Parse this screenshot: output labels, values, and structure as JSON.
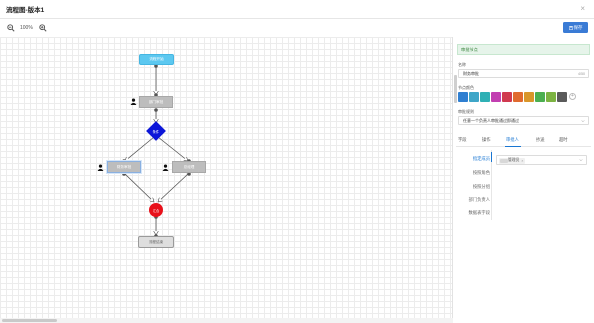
{
  "window": {
    "title": "流程图-版本1",
    "close_glyph": "×"
  },
  "toolbar": {
    "zoom_out_icon": "zoom-out-icon",
    "zoom_value": "100%",
    "zoom_in_icon": "zoom-in-icon",
    "save_label": "保存",
    "save_icon": "save-icon",
    "save_color": "#3a7bd5"
  },
  "flow": {
    "start": "流程开始",
    "task1": "部门审批",
    "gateway": "条件",
    "task2": "财务审批",
    "task3": "总经理",
    "merge": "汇合",
    "end": "流程结束"
  },
  "panel": {
    "banner": "审批节点",
    "name_label": "名称",
    "name_value": "财务审批",
    "name_counter": "4/50",
    "color_label": "节点颜色",
    "colors": [
      "#2f7fd1",
      "#3fa6c8",
      "#2fb0b5",
      "#c23fb1",
      "#d03a4f",
      "#e06a2e",
      "#d9962a",
      "#4caf50",
      "#7cb342",
      "#5a5a5a"
    ],
    "add_color_glyph": "+",
    "rule_label": "审批规则",
    "rule_value": "任意一个负责人审批通过即通过",
    "tabs": [
      "字段",
      "操作",
      "审批人",
      "抄送",
      "超时"
    ],
    "active_tab": "审批人",
    "subnav": [
      "指定成员",
      "按照角色",
      "按照分组",
      "部门负责人",
      "数据表字段"
    ],
    "active_subnav": "指定成员",
    "member_chip": "管理员"
  }
}
